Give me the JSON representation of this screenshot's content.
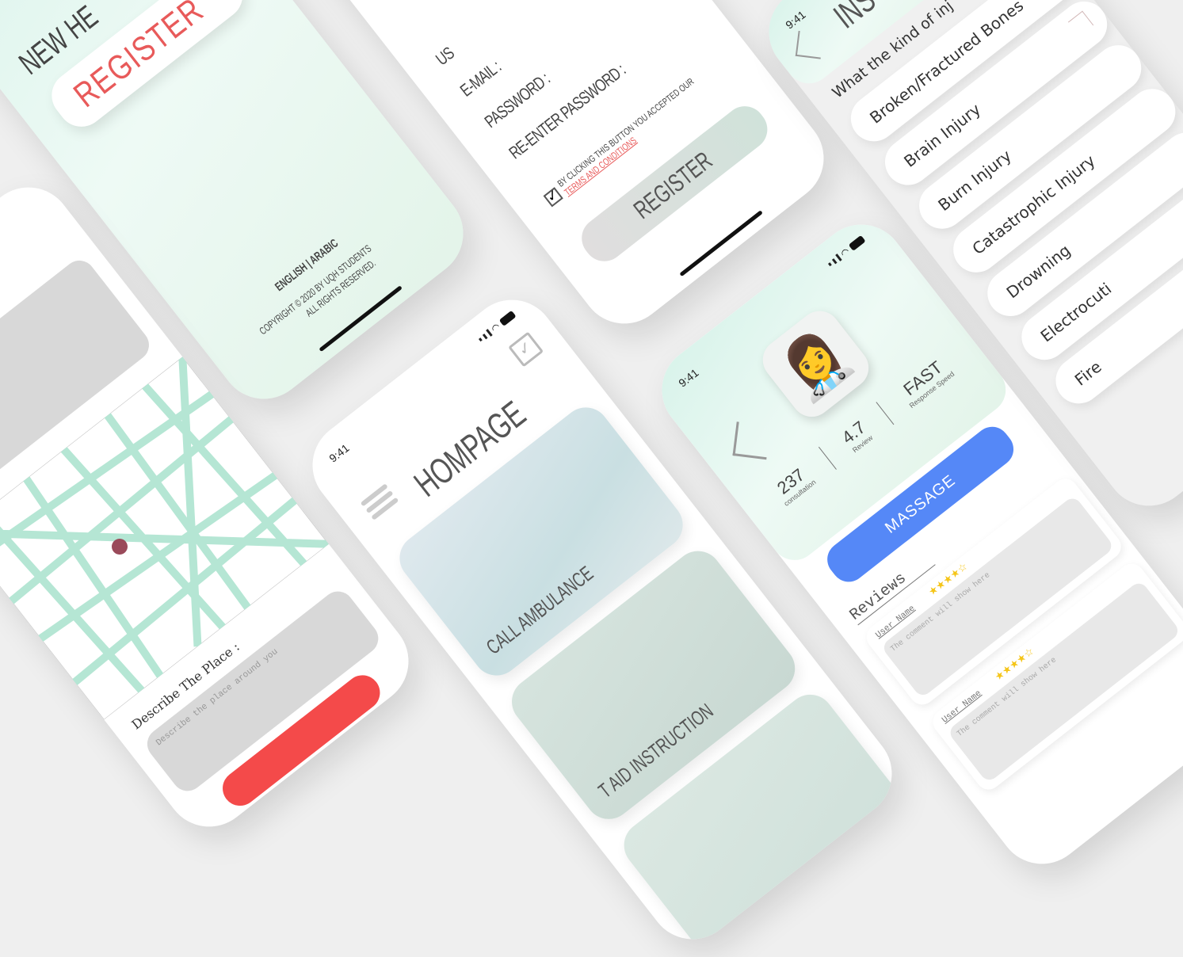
{
  "colors": {
    "background": "#efefef",
    "mint": "#d8f3ea",
    "accent_blue": "#5588f7",
    "accent_red": "#f44a4a",
    "link_red": "#e85a5a",
    "star": "#f5c518",
    "map_road": "#b5e6d4",
    "map_pin": "#9a4a5a"
  },
  "status_time": "9:41",
  "landing": {
    "heading": "NEW HE",
    "register_label": "REGISTER",
    "lang_english": "ENGLISH",
    "lang_sep": "|",
    "lang_arabic": "ARABIC",
    "copyright_line1": "COPYRIGHT © 2020 BY UQH STUDENTS",
    "copyright_line2": "ALL RIGHTS RESERVED."
  },
  "register_form": {
    "username_label": "US",
    "email_label": "E-MAIL :",
    "password_label": "PASSWORD :",
    "reenter_label": "RE-ENTER PASSWORD :",
    "consent_text": "BY CLICKING THIS BUTTON YOU ACCEPTED OUR",
    "terms_link": "TERMS AND CONDITIONS",
    "checkbox_checked": true,
    "register_label": "REGISTER"
  },
  "map_screen": {
    "describe_label": "Describe The Place :",
    "describe_placeholder": "Describe the place around you"
  },
  "homepage": {
    "title": "HOMPAGE",
    "icons": [
      "menu-icon",
      "edit-icon"
    ],
    "cards": [
      {
        "label": "CALL AMBULANCE"
      },
      {
        "label": "T AID INSTRUCTION"
      },
      {
        "label": ""
      }
    ]
  },
  "profile": {
    "stats": [
      {
        "value": "237",
        "label": "consultation"
      },
      {
        "value": "4.7",
        "label": "Review"
      },
      {
        "value": "FAST",
        "label": "Response Speed"
      }
    ],
    "massage_label": "MASSAGE",
    "reviews_heading": "Reviews",
    "reviews": [
      {
        "user": "User Name",
        "rating": 4.5,
        "comment": "The comment will show here"
      },
      {
        "user": "User Name",
        "rating": 4.5,
        "comment": "The comment will show here"
      }
    ]
  },
  "injury": {
    "header": "INS",
    "question": "What the kind of inj",
    "items": [
      "Broken/Fractured Bones",
      "Brain Injury",
      "Burn Injury",
      "Catastrophic Injury",
      "Drowning",
      "Electrocuti",
      "Fire"
    ]
  }
}
